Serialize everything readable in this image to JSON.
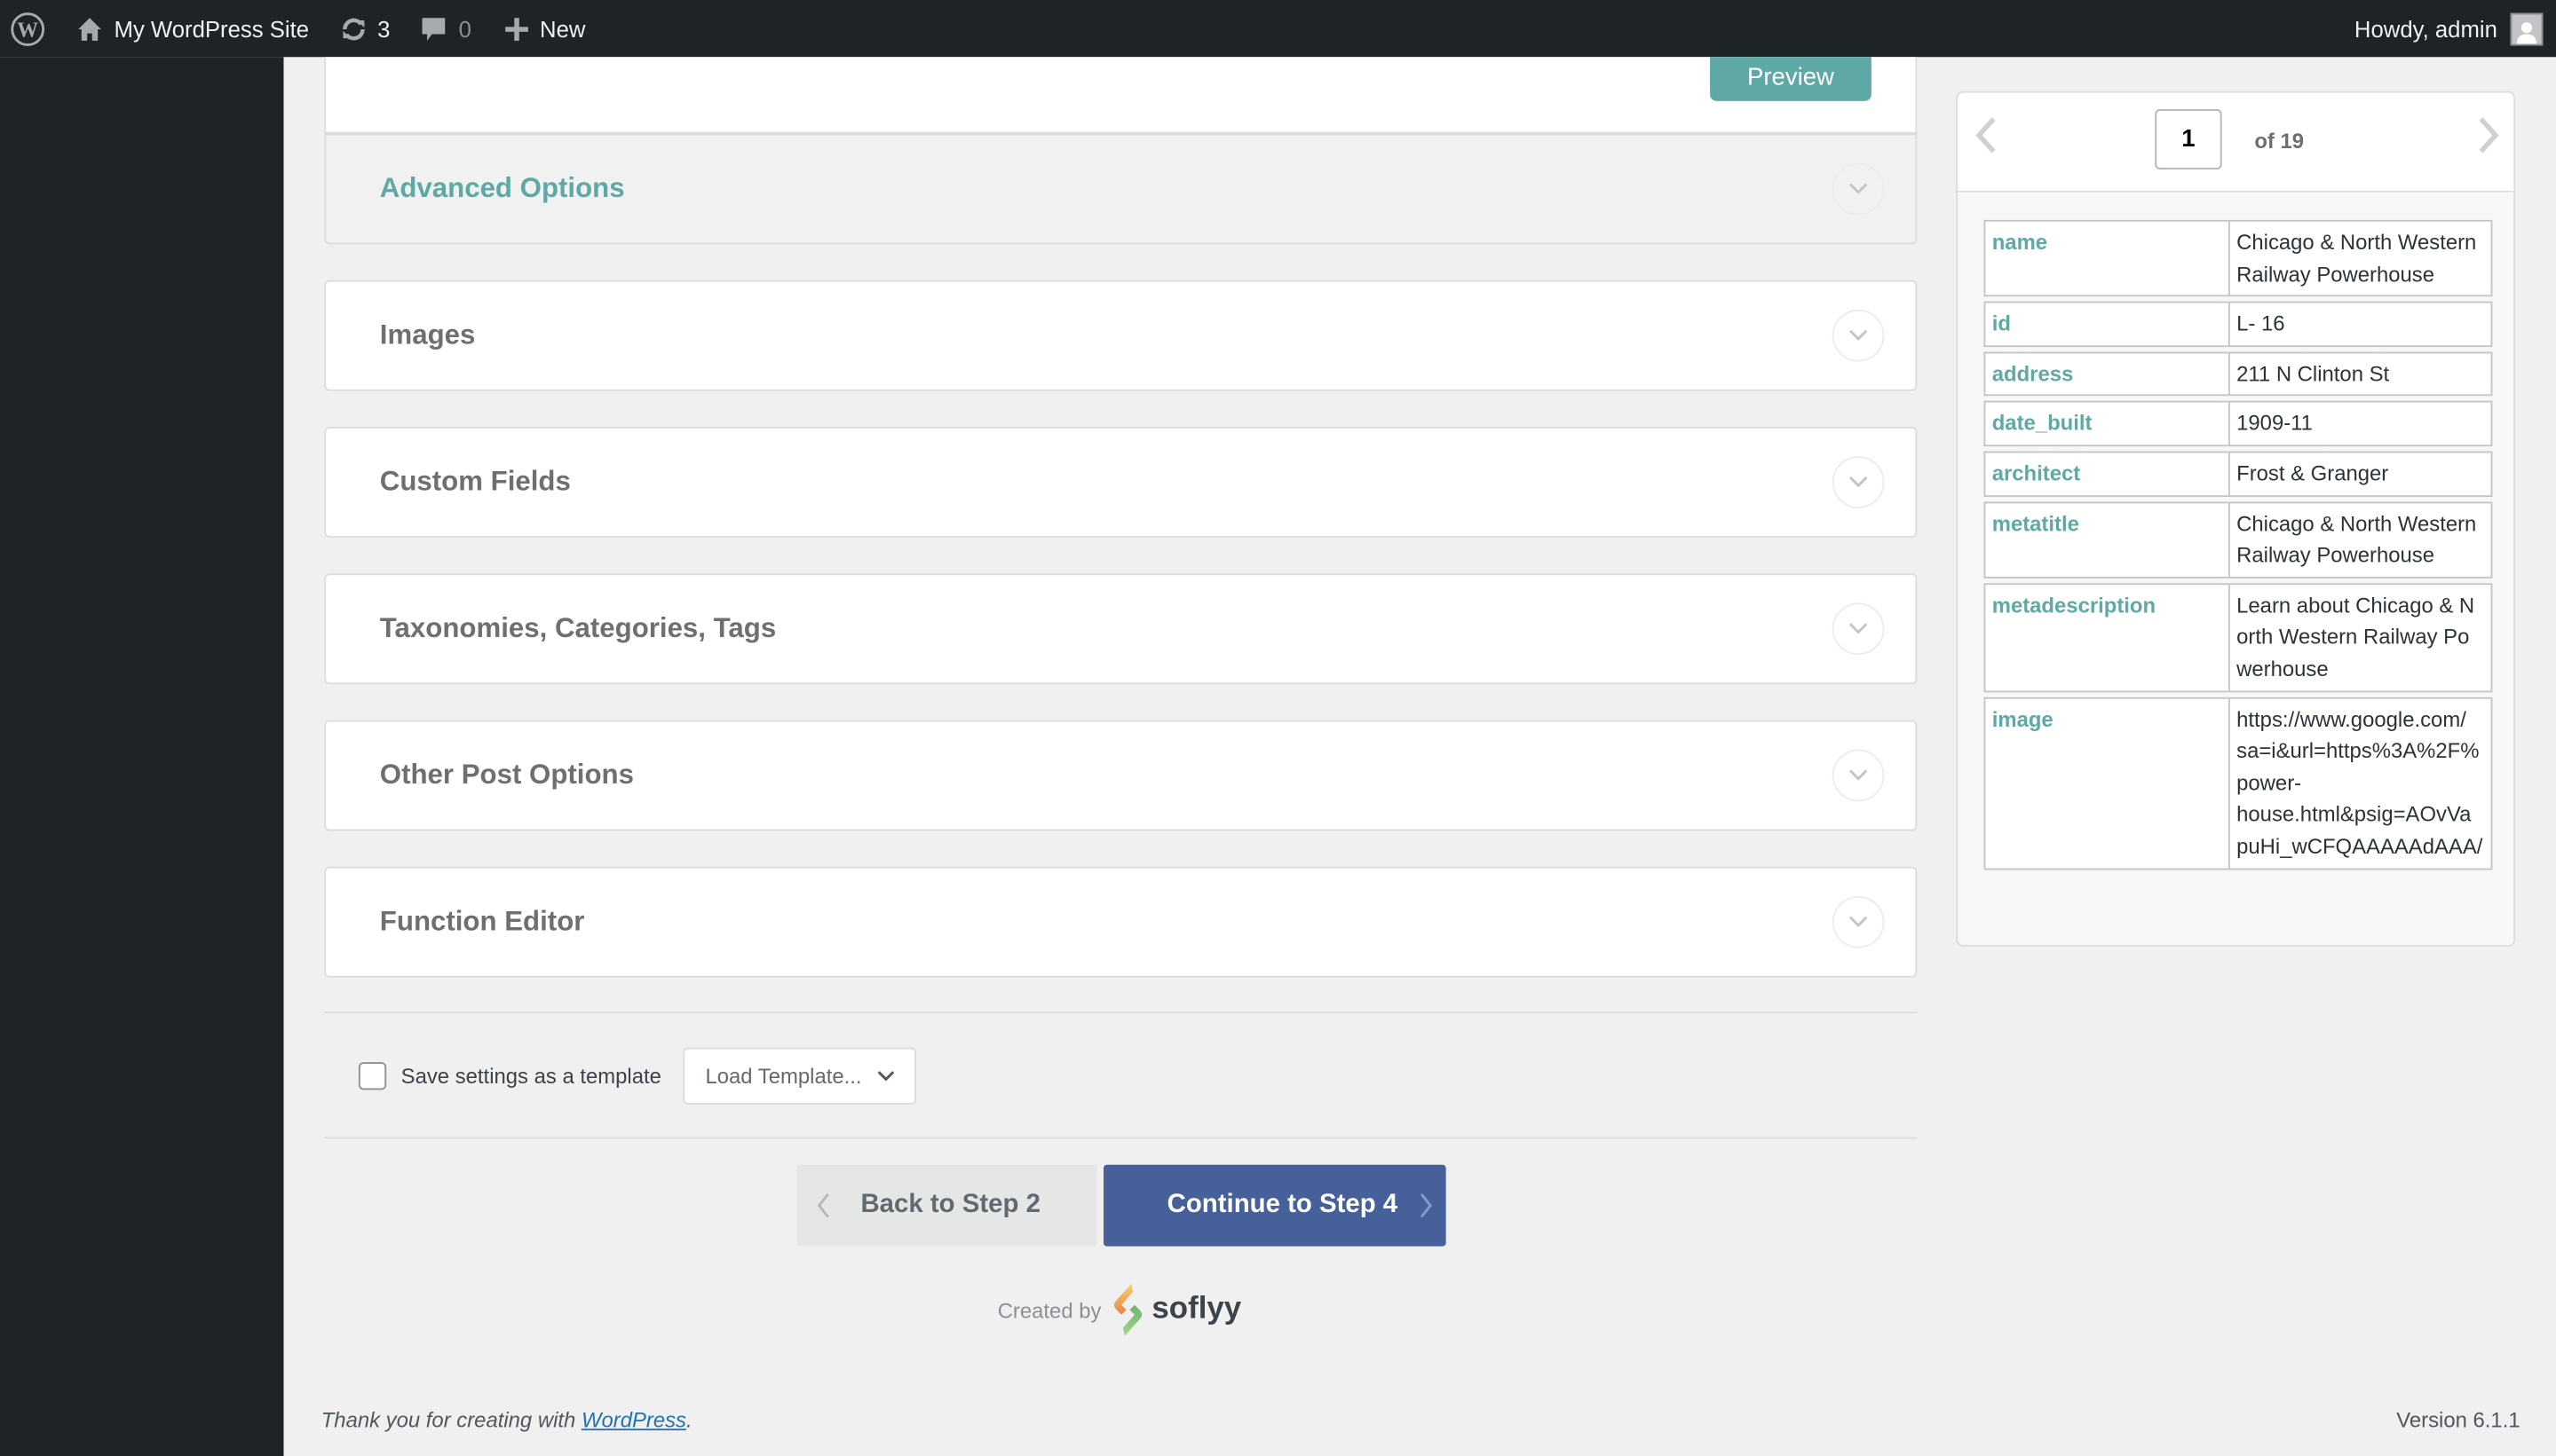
{
  "admin_bar": {
    "site_name": "My WordPress Site",
    "updates_count": "3",
    "comments_count": "0",
    "new_label": "New",
    "greeting": "Howdy, admin"
  },
  "main": {
    "preview_button": "Preview",
    "sections": [
      {
        "title": "Advanced Options",
        "state": "collapsed"
      },
      {
        "title": "Images",
        "state": "collapsed"
      },
      {
        "title": "Custom Fields",
        "state": "collapsed"
      },
      {
        "title": "Taxonomies, Categories, Tags",
        "state": "collapsed"
      },
      {
        "title": "Other Post Options",
        "state": "collapsed"
      },
      {
        "title": "Function Editor",
        "state": "collapsed"
      }
    ],
    "save_template_label": "Save settings as a template",
    "save_template_checked": false,
    "load_template_select": "Load Template...",
    "back_button": "Back to Step 2",
    "continue_button": "Continue to Step 4",
    "credit_prefix": "Created by",
    "credit_brand": "soflyy"
  },
  "preview": {
    "current_record": "1",
    "total_label": "of 19",
    "fields": [
      {
        "key": "name",
        "value": "Chicago & North Western Railway Powerhouse"
      },
      {
        "key": "id",
        "value": "L- 16"
      },
      {
        "key": "address",
        "value": "211 N Clinton St"
      },
      {
        "key": "date_built",
        "value": "1909-11"
      },
      {
        "key": "architect",
        "value": "Frost & Granger"
      },
      {
        "key": "metatitle",
        "value": "Chicago & North Western Railway Powerhouse"
      },
      {
        "key": "metadescription",
        "value": "Learn about Chicago & North Western Railway Powerhouse"
      },
      {
        "key": "image",
        "value_lines": [
          "https://www.google.com/",
          "sa=i&url=https%3A%2F%",
          "power-",
          "house.html&psig=AOvVa",
          "puHi_wCFQAAAAAdAAA/"
        ]
      }
    ]
  },
  "footer": {
    "thanks_prefix": "Thank you for creating with ",
    "thanks_link": "WordPress",
    "thanks_suffix": ".",
    "version": "Version 6.1.1"
  },
  "colors": {
    "accent_teal": "#5ea9a5",
    "primary_blue": "#46609a",
    "admin_dark": "#1d2327"
  }
}
